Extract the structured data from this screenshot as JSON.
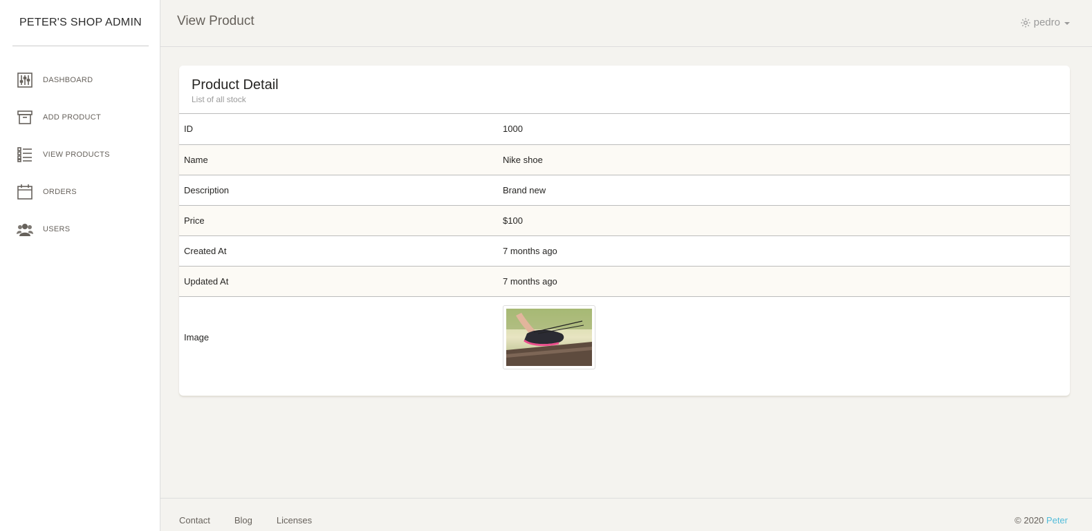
{
  "brand": "PETER'S SHOP ADMIN",
  "sidebar": {
    "items": [
      {
        "label": "DASHBOARD",
        "icon": "sliders-icon"
      },
      {
        "label": "ADD PRODUCT",
        "icon": "archive-box-icon"
      },
      {
        "label": "VIEW PRODUCTS",
        "icon": "list-icon"
      },
      {
        "label": "ORDERS",
        "icon": "calendar-icon"
      },
      {
        "label": "USERS",
        "icon": "users-icon"
      }
    ]
  },
  "header": {
    "title": "View Product",
    "user": "pedro",
    "user_icon": "gear-icon"
  },
  "card": {
    "title": "Product Detail",
    "subtitle": "List of all stock"
  },
  "details": [
    {
      "key": "ID",
      "value": "1000"
    },
    {
      "key": "Name",
      "value": "Nike shoe"
    },
    {
      "key": "Description",
      "value": "Brand new"
    },
    {
      "key": "Price",
      "value": "$100"
    },
    {
      "key": "Created At",
      "value": "7 months ago"
    },
    {
      "key": "Updated At",
      "value": "7 months ago"
    }
  ],
  "image_row": {
    "key": "Image",
    "alt": "product-image"
  },
  "footer": {
    "links": [
      "Contact",
      "Blog",
      "Licenses"
    ],
    "copyright_prefix": "© 2020",
    "copyright_name": "Peter"
  },
  "colors": {
    "accent": "#51bcda",
    "background": "#f4f3ef",
    "alt_row": "#fcfaf5"
  }
}
